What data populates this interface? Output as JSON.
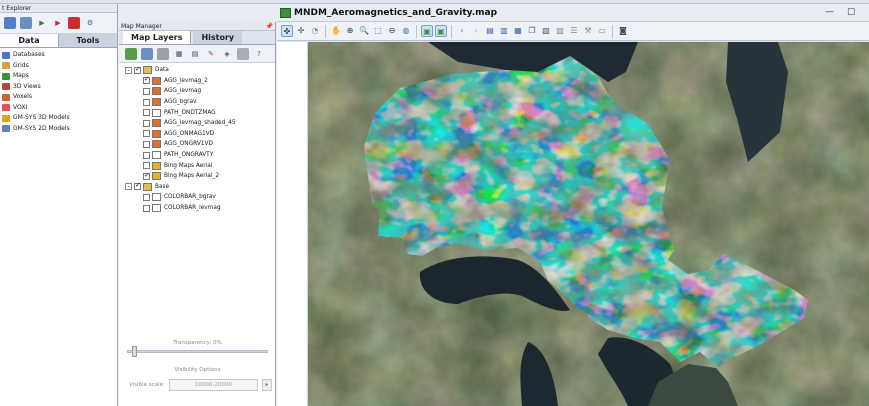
{
  "explorer": {
    "title": "t Explorer",
    "tabs": [
      {
        "label": "Data",
        "active": true
      },
      {
        "label": "Tools",
        "active": false
      }
    ],
    "items": [
      {
        "label": "Databases",
        "icon": "database-icon",
        "color": "#4a78c8"
      },
      {
        "label": "Grids",
        "icon": "grid-icon",
        "color": "#d8a040"
      },
      {
        "label": "Maps",
        "icon": "map-icon",
        "color": "#3d8f3d"
      },
      {
        "label": "3D Views",
        "icon": "cube-icon",
        "color": "#c04040"
      },
      {
        "label": "Voxels",
        "icon": "voxel-icon",
        "color": "#d06030"
      },
      {
        "label": "VOXI",
        "icon": "voxi-icon",
        "color": "#e05050"
      },
      {
        "label": "GM-SYS 3D Models",
        "icon": "model3d-icon",
        "color": "#e0a020"
      },
      {
        "label": "GM-SYS 2D Models",
        "icon": "model2d-icon",
        "color": "#6080c0"
      }
    ]
  },
  "mapmanager": {
    "title": "Map Manager",
    "tabs": [
      {
        "label": "Map Layers",
        "active": true
      },
      {
        "label": "History",
        "active": false
      }
    ],
    "layers": [
      {
        "indent": 0,
        "expander": "-",
        "checked": true,
        "label": "Data",
        "icon_color": "#e0c050",
        "group": true
      },
      {
        "indent": 1,
        "checked": true,
        "label": "AGG_levmag_2",
        "icon_color": "#e07030"
      },
      {
        "indent": 1,
        "checked": false,
        "label": "AGG_levmag",
        "icon_color": "#e07030"
      },
      {
        "indent": 1,
        "checked": false,
        "label": "AGG_bgrav",
        "icon_color": "#e07030"
      },
      {
        "indent": 1,
        "checked": false,
        "label": "PATH_ONDTZMAG",
        "icon_color": "#ffffff"
      },
      {
        "indent": 1,
        "checked": false,
        "label": "AGG_levmag_shaded_45",
        "icon_color": "#e07030"
      },
      {
        "indent": 1,
        "checked": false,
        "label": "AGG_ONMAG1VD",
        "icon_color": "#e07030"
      },
      {
        "indent": 1,
        "checked": false,
        "label": "AGG_ONGRV1VD",
        "icon_color": "#e07030"
      },
      {
        "indent": 1,
        "checked": false,
        "label": "PATH_ONGRAVTY",
        "icon_color": "#ffffff"
      },
      {
        "indent": 1,
        "checked": false,
        "label": "Bing Maps Aerial",
        "icon_color": "#e0b030"
      },
      {
        "indent": 1,
        "checked": true,
        "label": "Bing Maps Aerial_2",
        "icon_color": "#e0b030"
      },
      {
        "indent": 0,
        "expander": "-",
        "checked": true,
        "label": "Base",
        "icon_color": "#e0c050",
        "group": true
      },
      {
        "indent": 1,
        "checked": false,
        "label": "COLORBAR_bgrav",
        "icon_color": "#ffffff"
      },
      {
        "indent": 1,
        "checked": false,
        "label": "COLORBAR_levmag",
        "icon_color": "#ffffff"
      }
    ],
    "transparency_label": "Transparency: 0%",
    "transparency_percent": 0,
    "visibility_options_label": "Visibility Options",
    "visible_scale_label": "Visible scale:",
    "visible_scale_value": "10000-20000"
  },
  "mapwindow": {
    "title": "MNDM_Aeromagnetics_and_Gravity.map",
    "min_label": "—",
    "restore_label": "▢"
  },
  "colors": {
    "panel_bg": "#ffffff",
    "chrome_bg": "#dfe5ee",
    "accent": "#7aa0d0",
    "lake": "#1f2b34",
    "land": "#5c6a48"
  }
}
